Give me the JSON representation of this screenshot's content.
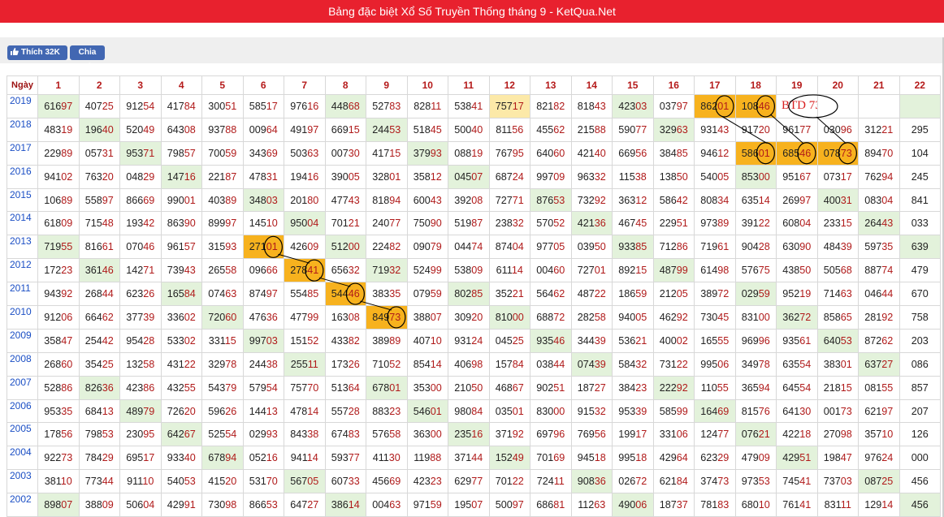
{
  "page_title": "Bảng đặc biệt Xổ Số Truyền Thống tháng 9 - KetQua.Net",
  "social": {
    "like_label": "Thích 32K",
    "share_label": "Chia sẻ"
  },
  "table": {
    "corner_label": "Ngày",
    "day_headers": [
      "1",
      "2",
      "3",
      "4",
      "5",
      "6",
      "7",
      "8",
      "9",
      "10",
      "11",
      "12",
      "13",
      "14",
      "15",
      "16",
      "17",
      "18",
      "19",
      "20",
      "21",
      "22"
    ],
    "annotation_text": "BTD",
    "rows": [
      {
        "year": "2019",
        "cells": [
          "61697",
          "40725",
          "91254",
          "41784",
          "30051",
          "58517",
          "97616",
          "44868",
          "52783",
          "82811",
          "53841",
          "75717",
          "82182",
          "81843",
          "42303",
          "03797",
          "86201",
          "10846",
          "BTD 73",
          "",
          "",
          ""
        ]
      },
      {
        "year": "2018",
        "cells": [
          "48319",
          "19640",
          "52049",
          "64308",
          "93788",
          "00964",
          "49197",
          "66915",
          "24453",
          "51845",
          "50040",
          "81156",
          "45562",
          "21588",
          "59077",
          "32963",
          "93143",
          "91720",
          "96177",
          "03096",
          "31221",
          "295"
        ]
      },
      {
        "year": "2017",
        "cells": [
          "22989",
          "05731",
          "95371",
          "79857",
          "70059",
          "34369",
          "50363",
          "00730",
          "41715",
          "37993",
          "08819",
          "76795",
          "64060",
          "42140",
          "66956",
          "38485",
          "94612",
          "58601",
          "68546",
          "07873",
          "89470",
          "104"
        ]
      },
      {
        "year": "2016",
        "cells": [
          "94102",
          "76320",
          "04829",
          "14716",
          "22187",
          "47831",
          "19416",
          "39005",
          "32801",
          "35812",
          "04507",
          "68724",
          "99709",
          "96332",
          "11538",
          "13850",
          "54005",
          "85300",
          "95167",
          "07317",
          "76294",
          "245"
        ]
      },
      {
        "year": "2015",
        "cells": [
          "10689",
          "55897",
          "86669",
          "99001",
          "40389",
          "34803",
          "20180",
          "47743",
          "81894",
          "60043",
          "39208",
          "72771",
          "87653",
          "73292",
          "36312",
          "58642",
          "80834",
          "63514",
          "26997",
          "40031",
          "08304",
          "841"
        ]
      },
      {
        "year": "2014",
        "cells": [
          "61809",
          "71548",
          "19342",
          "86390",
          "89997",
          "14510",
          "95004",
          "70121",
          "24077",
          "75090",
          "51987",
          "23832",
          "57052",
          "42136",
          "46745",
          "22951",
          "97389",
          "39122",
          "60804",
          "23315",
          "26443",
          "033"
        ]
      },
      {
        "year": "2013",
        "cells": [
          "71955",
          "81661",
          "07046",
          "96157",
          "31593",
          "27101",
          "42609",
          "51200",
          "22482",
          "09079",
          "04474",
          "87404",
          "97705",
          "03950",
          "93385",
          "71286",
          "71961",
          "90428",
          "63090",
          "48439",
          "59735",
          "639"
        ]
      },
      {
        "year": "2012",
        "cells": [
          "17223",
          "36146",
          "14271",
          "73943",
          "26558",
          "09666",
          "27841",
          "65632",
          "71932",
          "52499",
          "53809",
          "61114",
          "00460",
          "72701",
          "89215",
          "48799",
          "61498",
          "57675",
          "43850",
          "50568",
          "88774",
          "479"
        ]
      },
      {
        "year": "2011",
        "cells": [
          "94392",
          "26844",
          "62326",
          "16584",
          "07463",
          "87497",
          "55485",
          "54446",
          "38335",
          "07959",
          "80285",
          "35221",
          "56462",
          "48722",
          "18659",
          "21205",
          "38972",
          "02959",
          "95219",
          "71463",
          "04644",
          "670"
        ]
      },
      {
        "year": "2010",
        "cells": [
          "91206",
          "66462",
          "37739",
          "33602",
          "72060",
          "47636",
          "47799",
          "16308",
          "84973",
          "38807",
          "30920",
          "81000",
          "68872",
          "28258",
          "94005",
          "46292",
          "73045",
          "83100",
          "36272",
          "85865",
          "28192",
          "758"
        ]
      },
      {
        "year": "2009",
        "cells": [
          "35847",
          "25442",
          "95428",
          "53302",
          "33115",
          "99703",
          "15152",
          "43382",
          "38989",
          "40710",
          "93124",
          "04525",
          "93546",
          "34439",
          "53621",
          "40002",
          "16555",
          "96996",
          "93561",
          "64053",
          "87262",
          "203"
        ]
      },
      {
        "year": "2008",
        "cells": [
          "26860",
          "35425",
          "13258",
          "43122",
          "32978",
          "24438",
          "25511",
          "17326",
          "71052",
          "85414",
          "40698",
          "15784",
          "03844",
          "07439",
          "58432",
          "73122",
          "99506",
          "34978",
          "63554",
          "38301",
          "63727",
          "086"
        ]
      },
      {
        "year": "2007",
        "cells": [
          "52886",
          "82636",
          "42386",
          "43255",
          "54379",
          "57954",
          "75770",
          "51364",
          "67801",
          "35300",
          "21050",
          "46867",
          "90251",
          "18727",
          "38423",
          "22292",
          "11055",
          "36594",
          "64554",
          "21815",
          "08155",
          "857"
        ]
      },
      {
        "year": "2006",
        "cells": [
          "95335",
          "68413",
          "48979",
          "72620",
          "59626",
          "14413",
          "47814",
          "55728",
          "88323",
          "54601",
          "98084",
          "03501",
          "83000",
          "91532",
          "95339",
          "58599",
          "16469",
          "81576",
          "64130",
          "00173",
          "62197",
          "207"
        ]
      },
      {
        "year": "2005",
        "cells": [
          "17856",
          "79853",
          "23095",
          "64267",
          "52554",
          "02993",
          "84338",
          "67483",
          "57658",
          "36300",
          "23516",
          "37192",
          "69796",
          "76956",
          "19917",
          "33106",
          "12477",
          "07621",
          "42218",
          "27098",
          "35710",
          "126"
        ]
      },
      {
        "year": "2004",
        "cells": [
          "92273",
          "78429",
          "69517",
          "93340",
          "67894",
          "05216",
          "94114",
          "59377",
          "41130",
          "11988",
          "37144",
          "15249",
          "70169",
          "94518",
          "99518",
          "42964",
          "62329",
          "47909",
          "42951",
          "19847",
          "97624",
          "000"
        ]
      },
      {
        "year": "2003",
        "cells": [
          "38110",
          "77344",
          "91110",
          "54053",
          "41520",
          "53170",
          "56705",
          "60733",
          "45669",
          "42323",
          "62977",
          "70122",
          "72411",
          "90836",
          "02672",
          "62184",
          "37473",
          "97353",
          "74541",
          "73703",
          "08725",
          "456"
        ]
      },
      {
        "year": "2002",
        "cells": [
          "89807",
          "38809",
          "50604",
          "42991",
          "73098",
          "86653",
          "64727",
          "38614",
          "00463",
          "97159",
          "19507",
          "50097",
          "68681",
          "11263",
          "49006",
          "18737",
          "78183",
          "68010",
          "76141",
          "83111",
          "12914",
          "456"
        ]
      }
    ]
  },
  "highlights": {
    "green": [
      [
        0,
        0
      ],
      [
        0,
        7
      ],
      [
        0,
        14
      ],
      [
        0,
        21
      ],
      [
        1,
        1
      ],
      [
        1,
        8
      ],
      [
        1,
        15
      ],
      [
        2,
        2
      ],
      [
        2,
        9
      ],
      [
        3,
        3
      ],
      [
        3,
        10
      ],
      [
        3,
        17
      ],
      [
        4,
        5
      ],
      [
        4,
        12
      ],
      [
        4,
        19
      ],
      [
        5,
        6
      ],
      [
        5,
        13
      ],
      [
        5,
        20
      ],
      [
        6,
        0
      ],
      [
        6,
        7
      ],
      [
        6,
        14
      ],
      [
        6,
        21
      ],
      [
        7,
        1
      ],
      [
        7,
        8
      ],
      [
        7,
        15
      ],
      [
        8,
        3
      ],
      [
        8,
        10
      ],
      [
        8,
        17
      ],
      [
        9,
        4
      ],
      [
        9,
        11
      ],
      [
        9,
        18
      ],
      [
        10,
        5
      ],
      [
        10,
        12
      ],
      [
        10,
        19
      ],
      [
        11,
        6
      ],
      [
        11,
        13
      ],
      [
        11,
        20
      ],
      [
        12,
        1
      ],
      [
        12,
        8
      ],
      [
        12,
        15
      ],
      [
        13,
        2
      ],
      [
        13,
        9
      ],
      [
        13,
        16
      ],
      [
        14,
        3
      ],
      [
        14,
        10
      ],
      [
        14,
        17
      ],
      [
        15,
        4
      ],
      [
        15,
        11
      ],
      [
        15,
        18
      ],
      [
        16,
        6
      ],
      [
        16,
        13
      ],
      [
        16,
        20
      ],
      [
        17,
        0
      ],
      [
        17,
        7
      ],
      [
        17,
        14
      ],
      [
        17,
        21
      ]
    ],
    "yellow": [
      [
        0,
        11
      ]
    ],
    "orange": [
      [
        0,
        16
      ],
      [
        0,
        17
      ],
      [
        2,
        17
      ],
      [
        2,
        18
      ],
      [
        2,
        19
      ],
      [
        6,
        5
      ],
      [
        7,
        6
      ],
      [
        8,
        7
      ],
      [
        9,
        8
      ]
    ]
  },
  "annotation_color": "#000000"
}
